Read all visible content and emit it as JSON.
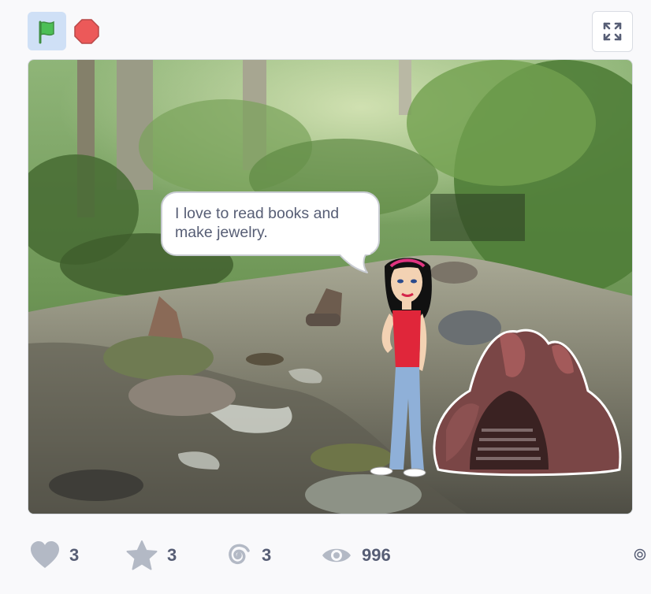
{
  "controls": {
    "green_flag": "green-flag-icon",
    "stop": "stop-icon",
    "fullscreen": "fullscreen-icon"
  },
  "stage": {
    "speech_bubble_text": "I love to read books and make jewelry.",
    "backdrop": "forest-stream",
    "sprites": [
      "girl-sprite",
      "cave-sprite"
    ]
  },
  "stats": {
    "loves": "3",
    "favorites": "3",
    "remixes": "3",
    "views": "996"
  },
  "colors": {
    "icon_gray": "#b3b9c5",
    "text_gray": "#575e75",
    "flag_green": "#4cbf56",
    "stop_red": "#ec5959",
    "flag_bg": "#cfe0f6"
  }
}
